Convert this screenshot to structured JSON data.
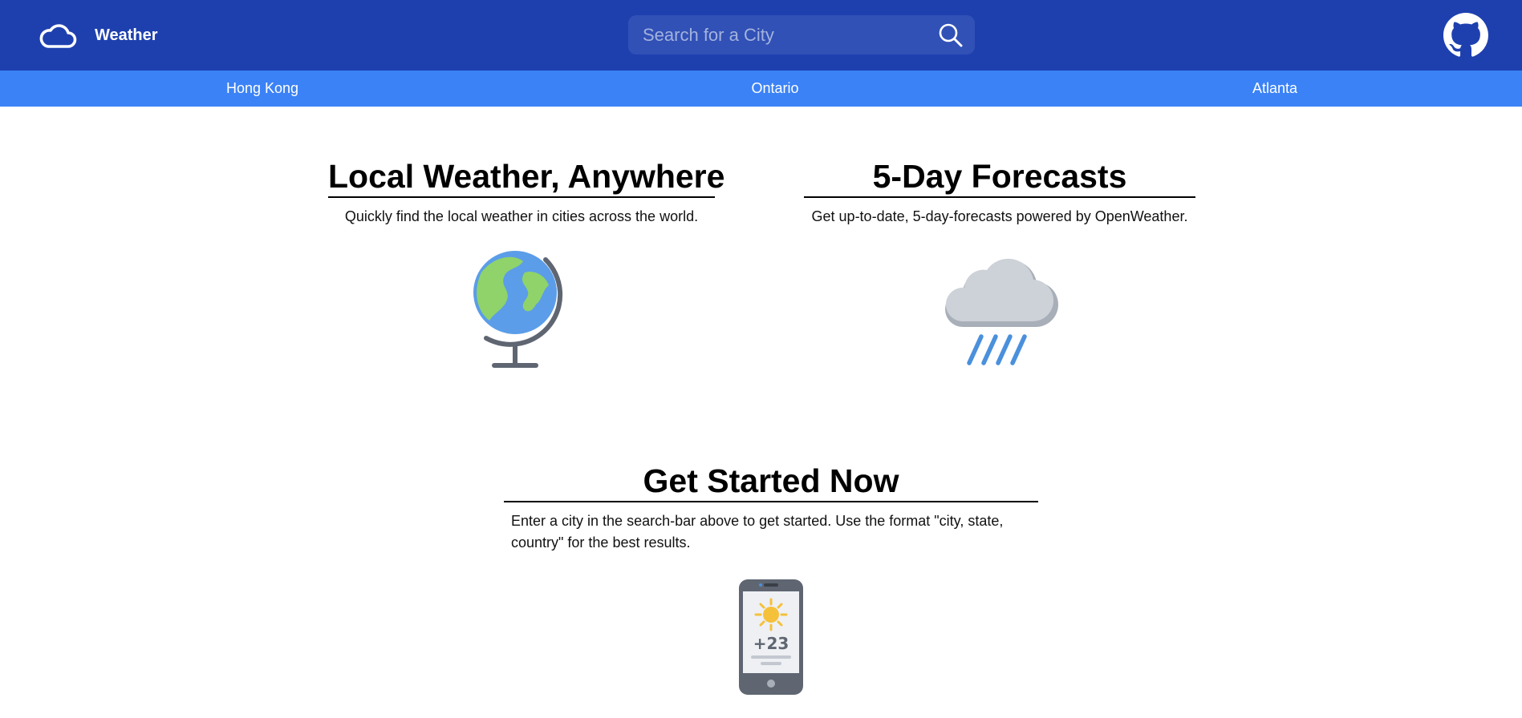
{
  "header": {
    "brand_label": "Weather",
    "brand_icon": "cloud-icon",
    "github_icon": "github-icon",
    "search": {
      "placeholder": "Search for a City",
      "value": "",
      "icon": "search-icon"
    }
  },
  "nav": {
    "cities": [
      "Hong Kong",
      "Ontario",
      "Atlanta"
    ]
  },
  "features": [
    {
      "title": "Local Weather, Anywhere",
      "description": "Quickly find the local weather in cities across the world.",
      "illustration": "globe-icon"
    },
    {
      "title": "5-Day Forecasts",
      "description": "Get up-to-date, 5-day-forecasts powered by OpenWeather.",
      "illustration": "rain-cloud-icon"
    },
    {
      "title": "Get Started Now",
      "description": "Enter a city in the search-bar above to get started. Use the format \"city, state, country\" for the best results.",
      "illustration": "phone-weather-icon",
      "phone_temperature": "+23"
    }
  ],
  "colors": {
    "header_bg": "#1e40af",
    "nav_bg": "#3b82f6",
    "search_bg": "#3151b6",
    "text": "#000000"
  }
}
